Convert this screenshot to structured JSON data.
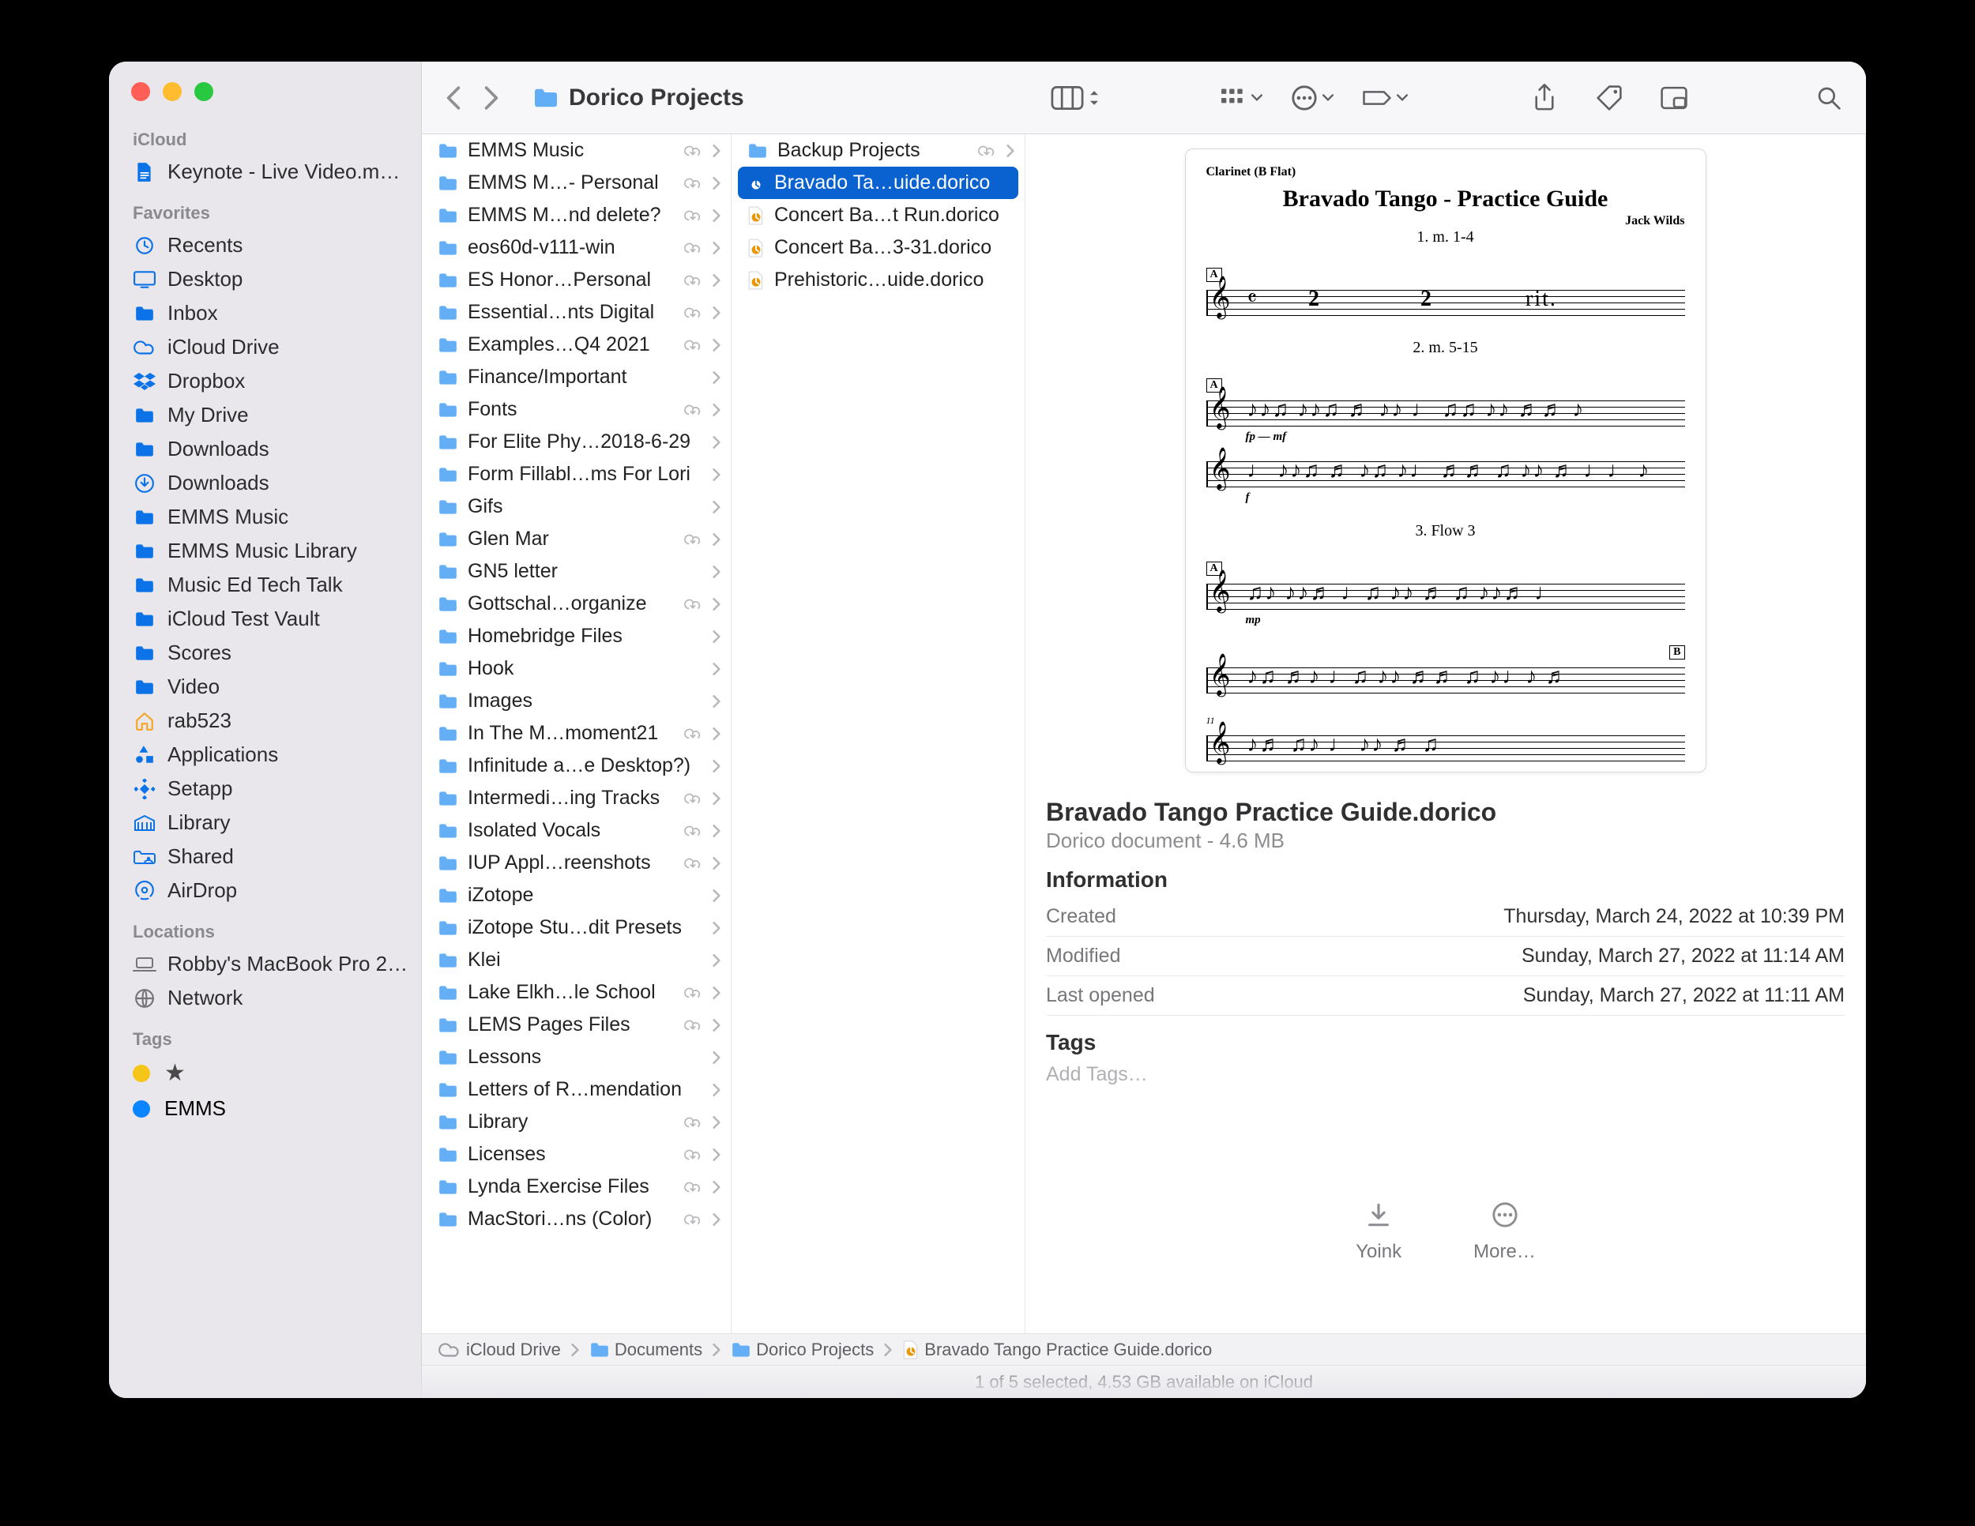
{
  "window": {
    "title": "Dorico Projects"
  },
  "toolbar": {
    "view": "columns",
    "icons": [
      "columns",
      "grid",
      "circle-ellipsis",
      "label",
      "share",
      "tag",
      "pip",
      "search"
    ]
  },
  "sidebar": {
    "sections": [
      {
        "label": "iCloud",
        "items": [
          {
            "icon": "doc-blue",
            "name": "Keynote - Live Video.m…"
          }
        ]
      },
      {
        "label": "Favorites",
        "items": [
          {
            "icon": "clock",
            "name": "Recents"
          },
          {
            "icon": "desktop",
            "name": "Desktop"
          },
          {
            "icon": "folder",
            "name": "Inbox"
          },
          {
            "icon": "cloud",
            "name": "iCloud Drive"
          },
          {
            "icon": "dropbox",
            "name": "Dropbox"
          },
          {
            "icon": "folder",
            "name": "My Drive"
          },
          {
            "icon": "folder",
            "name": "Downloads"
          },
          {
            "icon": "download",
            "name": "Downloads"
          },
          {
            "icon": "folder",
            "name": "EMMS Music"
          },
          {
            "icon": "folder",
            "name": "EMMS Music Library"
          },
          {
            "icon": "folder",
            "name": "Music Ed Tech Talk"
          },
          {
            "icon": "folder",
            "name": "iCloud Test Vault"
          },
          {
            "icon": "folder",
            "name": "Scores"
          },
          {
            "icon": "folder",
            "name": "Video"
          },
          {
            "icon": "home",
            "name": "rab523",
            "iconColor": "orange"
          },
          {
            "icon": "apps",
            "name": "Applications"
          },
          {
            "icon": "setapp",
            "name": "Setapp"
          },
          {
            "icon": "library",
            "name": "Library"
          },
          {
            "icon": "shared",
            "name": "Shared"
          },
          {
            "icon": "airdrop",
            "name": "AirDrop"
          }
        ]
      },
      {
        "label": "Locations",
        "items": [
          {
            "icon": "laptop",
            "name": "Robby's MacBook Pro 2…",
            "iconColor": "gray"
          },
          {
            "icon": "globe",
            "name": "Network",
            "iconColor": "gray"
          }
        ]
      },
      {
        "label": "Tags",
        "items": [
          {
            "icon": "tag-yellow",
            "name": "★"
          },
          {
            "icon": "tag-blue",
            "name": "EMMS"
          }
        ]
      }
    ]
  },
  "column1": [
    {
      "name": "EMMS Music",
      "cloud": true
    },
    {
      "name": "EMMS M…- Personal",
      "cloud": true
    },
    {
      "name": "EMMS M…nd delete?",
      "cloud": true
    },
    {
      "name": "eos60d-v111-win",
      "cloud": true
    },
    {
      "name": "ES Honor…Personal",
      "cloud": true
    },
    {
      "name": "Essential…nts Digital",
      "cloud": true
    },
    {
      "name": "Examples…Q4 2021",
      "cloud": true
    },
    {
      "name": "Finance/Important"
    },
    {
      "name": "Fonts",
      "cloud": true
    },
    {
      "name": "For Elite Phy…2018-6-29"
    },
    {
      "name": "Form Fillabl…ms For Lori"
    },
    {
      "name": "Gifs"
    },
    {
      "name": "Glen Mar",
      "cloud": true
    },
    {
      "name": "GN5 letter"
    },
    {
      "name": "Gottschal…organize",
      "cloud": true
    },
    {
      "name": "Homebridge Files"
    },
    {
      "name": "Hook"
    },
    {
      "name": "Images"
    },
    {
      "name": "In The M…moment21",
      "cloud": true
    },
    {
      "name": "Infinitude a…e Desktop?)"
    },
    {
      "name": "Intermedi…ing Tracks",
      "cloud": true
    },
    {
      "name": "Isolated Vocals",
      "cloud": true
    },
    {
      "name": "IUP Appl…reenshots",
      "cloud": true
    },
    {
      "name": "iZotope"
    },
    {
      "name": "iZotope Stu…dit Presets"
    },
    {
      "name": "Klei"
    },
    {
      "name": "Lake Elkh…le School",
      "cloud": true
    },
    {
      "name": "LEMS Pages Files",
      "cloud": true
    },
    {
      "name": "Lessons"
    },
    {
      "name": "Letters of R…mendation"
    },
    {
      "name": "Library",
      "cloud": true
    },
    {
      "name": "Licenses",
      "cloud": true
    },
    {
      "name": "Lynda Exercise Files",
      "cloud": true
    },
    {
      "name": "MacStori…ns (Color)",
      "cloud": true
    }
  ],
  "column2": [
    {
      "type": "folder",
      "name": "Backup Projects",
      "cloud": true
    },
    {
      "type": "file-blue",
      "name": "Bravado Ta…uide.dorico",
      "selected": true
    },
    {
      "type": "file-orange",
      "name": "Concert Ba…t Run.dorico"
    },
    {
      "type": "file-orange",
      "name": "Concert Ba…3-31.dorico"
    },
    {
      "type": "file-orange",
      "name": "Prehistoric…uide.dorico"
    }
  ],
  "info": {
    "file_name": "Bravado Tango Practice Guide.dorico",
    "kind_size": "Dorico document - 4.6 MB",
    "heading_info": "Information",
    "rows": [
      {
        "k": "Created",
        "v": "Thursday, March 24, 2022 at 10:39 PM"
      },
      {
        "k": "Modified",
        "v": "Sunday, March 27, 2022 at 11:14 AM"
      },
      {
        "k": "Last opened",
        "v": "Sunday, March 27, 2022 at 11:11 AM"
      }
    ],
    "heading_tags": "Tags",
    "add_tags": "Add Tags…",
    "actions": [
      {
        "name": "Yoink"
      },
      {
        "name": "More…"
      }
    ],
    "preview": {
      "instrument": "Clarinet (B Flat)",
      "title": "Bravado Tango - Practice Guide",
      "composer": "Jack Wilds",
      "flows": [
        "1. m. 1-4",
        "2. m. 5-15",
        "3. Flow 3"
      ],
      "markers": [
        "A",
        "A",
        "A",
        "B"
      ],
      "rehearsal_marks": [
        "2",
        "2",
        "rit.",
        "11"
      ],
      "dynamics": [
        "fp — mf",
        "f",
        "mp"
      ]
    }
  },
  "path": [
    {
      "icon": "cloud",
      "name": "iCloud Drive"
    },
    {
      "icon": "folder",
      "name": "Documents"
    },
    {
      "icon": "folder",
      "name": "Dorico Projects"
    },
    {
      "icon": "file-orange",
      "name": "Bravado Tango Practice Guide.dorico"
    }
  ],
  "status": "1 of 5 selected, 4.53 GB available on iCloud"
}
